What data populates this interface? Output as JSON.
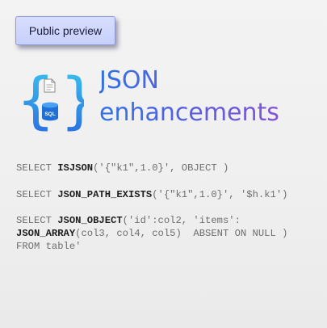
{
  "badge": {
    "label": "Public preview"
  },
  "logo": {
    "open_brace": "{",
    "close_brace": "}",
    "db_label": "SQL"
  },
  "title": {
    "line1": "JSON",
    "line2": "enhancements"
  },
  "code": {
    "line1": {
      "pre": "SELECT ",
      "kw": "ISJSON",
      "post": "('{\"k1\",1.0}', OBJECT )"
    },
    "line2": {
      "pre": "SELECT ",
      "kw": "JSON_PATH_EXISTS",
      "post": "('{\"k1\",1.0}', '$h.k1')"
    },
    "line3": {
      "pre": "SELECT ",
      "kw": "JSON_OBJECT",
      "post": "('id':col2, 'items':"
    },
    "line4": {
      "kw": "JSON_ARRAY",
      "post": "(col3, col4, col5)  ABSENT ON NULL )"
    },
    "line5": {
      "text": "FROM table'"
    }
  },
  "colors": {
    "accent_start": "#2f73e6",
    "accent_end": "#8352d8",
    "brace": "#2a7de1",
    "brace_2": "#3cc6f0"
  }
}
